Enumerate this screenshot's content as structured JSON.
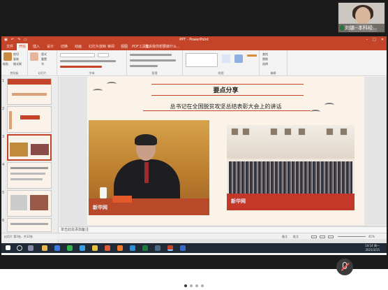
{
  "participant": {
    "name": "刘娜--本科经..."
  },
  "powerpoint": {
    "window_title": "PPT - PowerPoint",
    "tabs": [
      "文件",
      "开始",
      "插入",
      "设计",
      "切换",
      "动画",
      "幻灯片放映",
      "审阅",
      "视图",
      "PDF工具集"
    ],
    "active_tab_index": 1,
    "tell_me": "告诉我你想要做什么...",
    "ribbon_groups": [
      "剪贴板",
      "幻灯片",
      "字体",
      "段落",
      "绘图",
      "编辑"
    ],
    "ribbon_items": {
      "paste": "粘贴",
      "cut": "剪切",
      "copy": "复制",
      "format_painter": "格式刷",
      "new_slide": "新建\n幻灯片",
      "layout": "版式",
      "reset": "重置",
      "section": "节",
      "find": "查找",
      "replace": "替换",
      "select": "选择"
    },
    "thumbnail_numbers": [
      "1",
      "2",
      "3",
      "4",
      "5",
      "6"
    ],
    "selected_slide": 3,
    "notes_placeholder": "单击此处添加备注",
    "status": {
      "slide_counter": "幻灯片 第3张，共12张",
      "notes": "备注",
      "comments": "批注",
      "zoom": "41%"
    }
  },
  "slide": {
    "title": "要点分享",
    "subtitle": "总书记在全国脱贫攻坚总结表彰大会上的讲话",
    "left_photo_watermark": "新华网",
    "right_photo_watermark": "新华网"
  },
  "taskbar": {
    "time": "14:14 周一",
    "date": "2021/3/15",
    "colors": {
      "bar": "#1f2a36"
    }
  },
  "pager": {
    "pages": 4,
    "active": 0
  },
  "colors": {
    "ppt_accent": "#c4442a",
    "slide_bg": "#fbf3e8"
  }
}
